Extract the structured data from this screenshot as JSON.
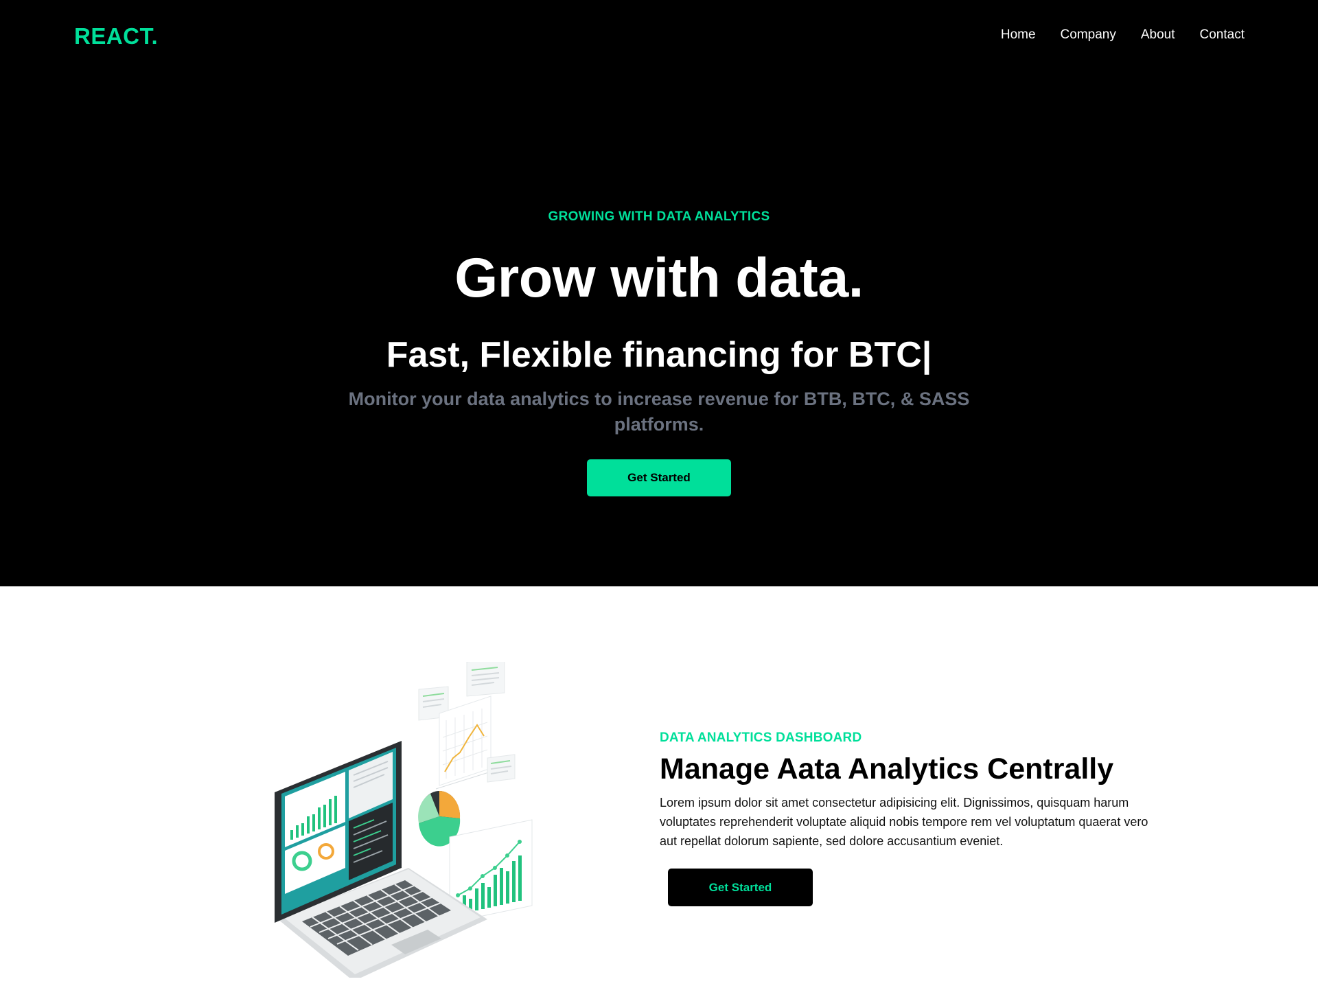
{
  "brand": {
    "logo": "REACT.",
    "accent_color": "#00df9a"
  },
  "nav": {
    "items": [
      {
        "label": "Home"
      },
      {
        "label": "Company"
      },
      {
        "label": "About"
      },
      {
        "label": "Contact"
      }
    ]
  },
  "hero": {
    "kicker": "GROWING WITH DATA ANALYTICS",
    "headline": "Grow with data.",
    "subhead": "Fast, Flexible financing for BTC|",
    "description": "Monitor your data analytics to increase revenue for BTB, BTC, & SASS platforms.",
    "cta_label": "Get Started"
  },
  "feature": {
    "kicker": "DATA ANALYTICS DASHBOARD",
    "title": "Manage Aata Analytics Centrally",
    "body": "Lorem ipsum dolor sit amet consectetur adipisicing elit. Dignissimos, quisquam harum voluptates reprehenderit voluptate aliquid nobis tempore rem vel voluptatum quaerat vero aut repellat dolorum sapiente, sed dolore accusantium eveniet.",
    "cta_label": "Get Started",
    "illustration_icon": "laptop-analytics-icon"
  }
}
